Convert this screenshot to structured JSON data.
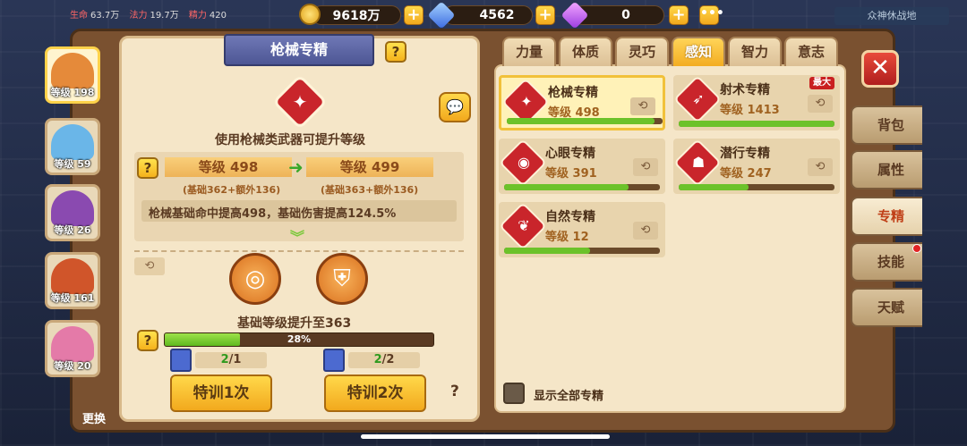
{
  "hud": {
    "hp_label": "生命",
    "hp_value": "63.7万",
    "mp_label": "法力",
    "mp_value": "19.7万",
    "other_label": "精力",
    "other_value": "420",
    "gold": "9618万",
    "diamond": "4562",
    "purple_gem": "0",
    "region": "众神休战地"
  },
  "heroes": [
    {
      "level": "等级 198",
      "selected": true,
      "color": "#e58a3a"
    },
    {
      "level": "等级 59",
      "selected": false,
      "color": "#6ab6e8"
    },
    {
      "level": "等级 26",
      "selected": false,
      "color": "#8a4ab0"
    },
    {
      "level": "等级 161",
      "selected": false,
      "color": "#d0552a"
    },
    {
      "level": "等级 20",
      "selected": false,
      "color": "#e47aa8"
    }
  ],
  "detail": {
    "title": "枪械专精",
    "description": "使用枪械类武器可提升等级",
    "current_level": "等级 498",
    "next_level": "等级 499",
    "current_breakdown": "(基础362+额外136)",
    "next_breakdown": "(基础363+额外136)",
    "bonus_text": "枪械基础命中提高498，基础伤害提高124.5%",
    "upgrade_text": "基础等级提升至363",
    "progress_percent": 28,
    "progress_label": "28%",
    "item1_have": "2",
    "item1_need": "/1",
    "item2_have": "2",
    "item2_need": "/2",
    "train1_label": "特训1次",
    "train2_label": "特训2次",
    "help_mark": "?"
  },
  "tabs": [
    {
      "label": "力量",
      "active": false
    },
    {
      "label": "体质",
      "active": false
    },
    {
      "label": "灵巧",
      "active": false
    },
    {
      "label": "感知",
      "active": true
    },
    {
      "label": "智力",
      "active": false
    },
    {
      "label": "意志",
      "active": false
    }
  ],
  "specs": [
    {
      "name": "枪械专精",
      "level": "等级 498",
      "progress": 0.95,
      "selected": true,
      "badge": "",
      "icon": "gun"
    },
    {
      "name": "射术专精",
      "level": "等级 1413",
      "progress": 1.0,
      "selected": false,
      "badge": "最大",
      "icon": "bow"
    },
    {
      "name": "心眼专精",
      "level": "等级 391",
      "progress": 0.8,
      "selected": false,
      "badge": "",
      "icon": "eye"
    },
    {
      "name": "潜行专精",
      "level": "等级 247",
      "progress": 0.45,
      "selected": false,
      "badge": "",
      "icon": "hood"
    },
    {
      "name": "自然专精",
      "level": "等级 12",
      "progress": 0.55,
      "selected": false,
      "badge": "",
      "icon": "leaf"
    }
  ],
  "show_all_label": "显示全部专精",
  "side_nav": [
    {
      "label": "背包",
      "active": false,
      "dot": false
    },
    {
      "label": "属性",
      "active": false,
      "dot": false
    },
    {
      "label": "专精",
      "active": true,
      "dot": false
    },
    {
      "label": "技能",
      "active": false,
      "dot": true
    },
    {
      "label": "天赋",
      "active": false,
      "dot": false
    }
  ],
  "change_label": "更换"
}
